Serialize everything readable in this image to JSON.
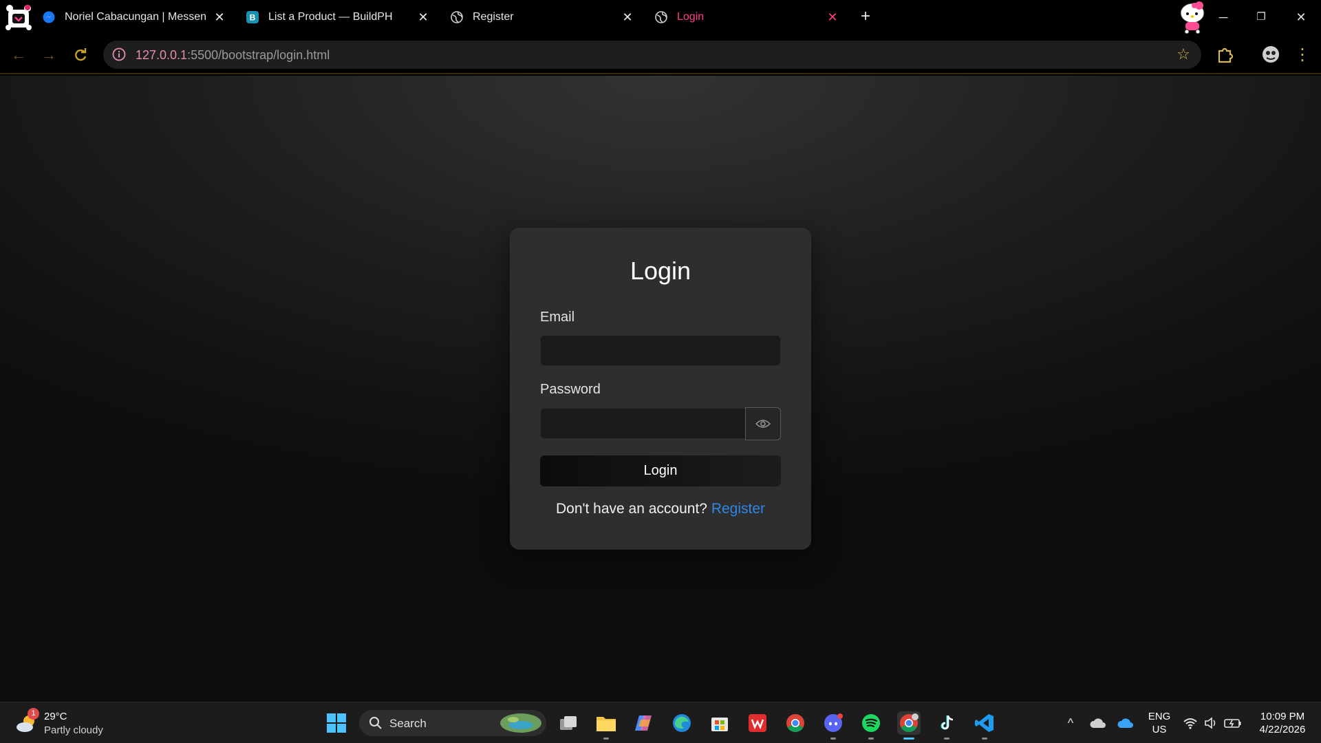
{
  "tabs": [
    {
      "title": "Noriel Cabacungan | Messenger",
      "favicon": "messenger-icon"
    },
    {
      "title": "List a Product — BuildPH",
      "favicon": "buildph-icon"
    },
    {
      "title": "Register",
      "favicon": "globe-icon"
    },
    {
      "title": "Login",
      "favicon": "globe-icon",
      "active": true
    }
  ],
  "address_bar": {
    "host": "127.0.0.1",
    "path": ":5500/bootstrap/login.html"
  },
  "page": {
    "heading": "Login",
    "email_label": "Email",
    "email_value": "",
    "password_label": "Password",
    "password_value": "",
    "login_button": "Login",
    "no_account_text": "Don't have an account?",
    "register_link": "Register"
  },
  "taskbar": {
    "weather_temp": "29°C",
    "weather_condition": "Partly cloudy",
    "weather_badge": "1",
    "search_label": "Search",
    "language_line1": "ENG",
    "language_line2": "US",
    "time": "10:09 PM",
    "date": "4/22/2026"
  },
  "colors": {
    "accent_pink": "#ff3d8b",
    "link_blue": "#2f86e6",
    "nav_gold": "#c9a227"
  }
}
